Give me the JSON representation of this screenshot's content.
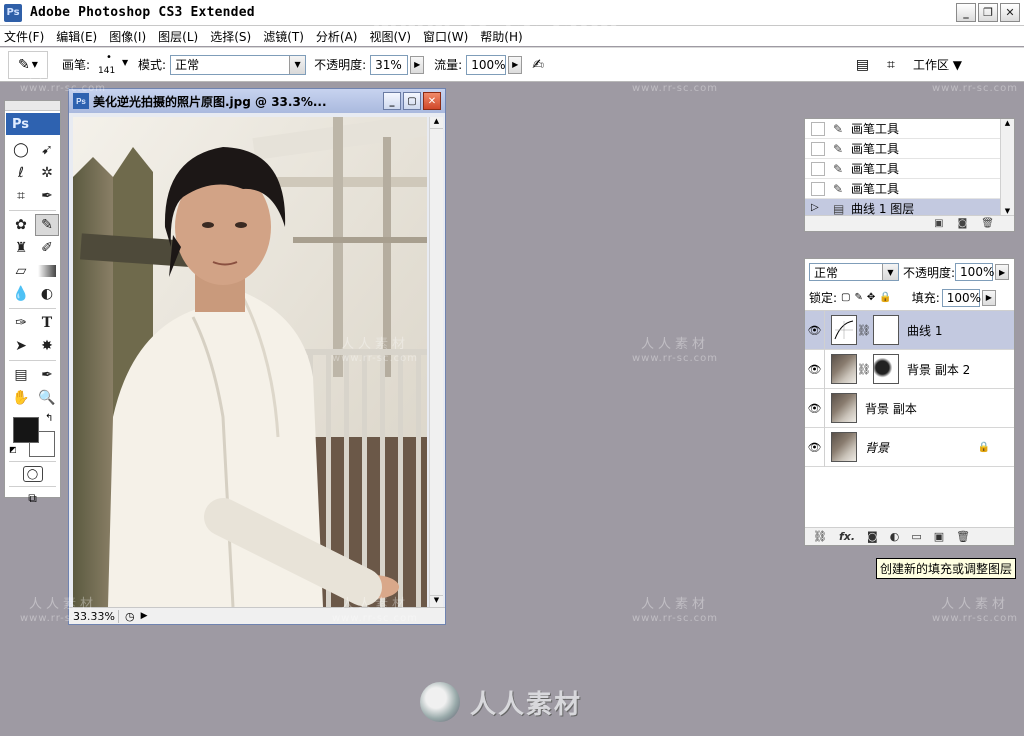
{
  "app": {
    "title": "Adobe Photoshop CS3 Extended",
    "icon_label": "Ps"
  },
  "menu": [
    "文件(F)",
    "编辑(E)",
    "图像(I)",
    "图层(L)",
    "选择(S)",
    "滤镜(T)",
    "分析(A)",
    "视图(V)",
    "窗口(W)",
    "帮助(H)"
  ],
  "options": {
    "brush_label": "画笔:",
    "brush_size": "141",
    "mode_label": "模式:",
    "mode_value": "正常",
    "opacity_label": "不透明度:",
    "opacity_value": "31%",
    "flow_label": "流量:",
    "flow_value": "100%",
    "workspace_label": "工作区"
  },
  "toolbox": {
    "logo": "Ps"
  },
  "document": {
    "title": "美化逆光拍摄的照片原图.jpg @ 33.3%...",
    "zoom": "33.33%"
  },
  "history": {
    "items": [
      {
        "label": "画笔工具",
        "active": false
      },
      {
        "label": "画笔工具",
        "active": false
      },
      {
        "label": "画笔工具",
        "active": false
      },
      {
        "label": "画笔工具",
        "active": false
      },
      {
        "label": "曲线 1 图层",
        "active": true
      }
    ]
  },
  "layers": {
    "blend_mode": "正常",
    "opacity_label": "不透明度:",
    "opacity_value": "100%",
    "lock_label": "锁定:",
    "fill_label": "填充:",
    "fill_value": "100%",
    "items": [
      {
        "name": "曲线 1",
        "active": true
      },
      {
        "name": "背景 副本 2",
        "active": false
      },
      {
        "name": "背景 副本",
        "active": false
      },
      {
        "name": "背景",
        "active": false
      }
    ],
    "footer_fx": "fx."
  },
  "tooltip": "创建新的填充或调整图层",
  "watermark": {
    "cn": "人人素材",
    "url": "www.rr-sc.com",
    "top_url": "www.rr-sc.com",
    "logo_text": "人人素材"
  },
  "colors": {
    "workspace_bg": "#9e9aa3",
    "accent": "#2e62b0",
    "selection": "#c3c9e0"
  }
}
